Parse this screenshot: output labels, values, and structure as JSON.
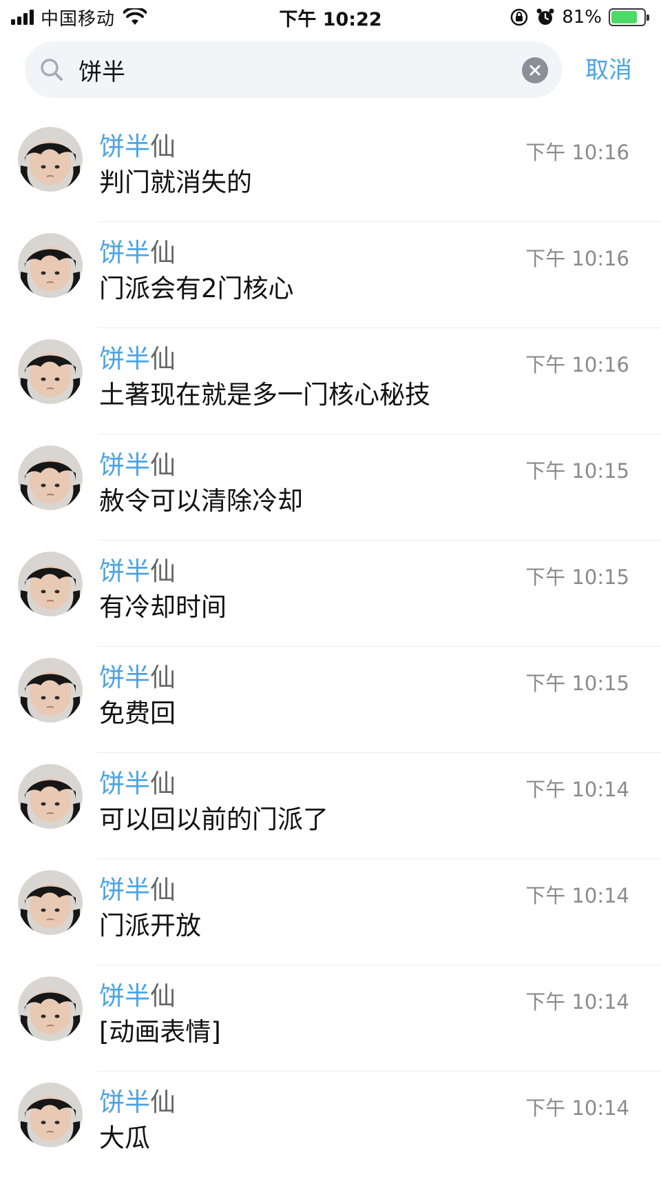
{
  "status": {
    "carrier": "中国移动",
    "time": "下午 10:22",
    "battery": "81%",
    "battery_level": 0.81,
    "icons": [
      "signal-icon",
      "wifi-icon",
      "rotation-lock-icon",
      "alarm-icon",
      "battery-charging-icon"
    ]
  },
  "search": {
    "query": "饼半",
    "cancel_label": "取消",
    "clear_icon": "clear-icon"
  },
  "colors": {
    "accent": "#4aa3e6",
    "highlight": "#4aa3e6",
    "secondary_text": "#8a8a8a"
  },
  "results": [
    {
      "name_match": "饼半",
      "name_rest": "仙",
      "time": "下午 10:16",
      "message": "判门就消失的"
    },
    {
      "name_match": "饼半",
      "name_rest": "仙",
      "time": "下午 10:16",
      "message": "门派会有2门核心"
    },
    {
      "name_match": "饼半",
      "name_rest": "仙",
      "time": "下午 10:16",
      "message": "土著现在就是多一门核心秘技"
    },
    {
      "name_match": "饼半",
      "name_rest": "仙",
      "time": "下午 10:15",
      "message": "赦令可以清除冷却"
    },
    {
      "name_match": "饼半",
      "name_rest": "仙",
      "time": "下午 10:15",
      "message": "有冷却时间"
    },
    {
      "name_match": "饼半",
      "name_rest": "仙",
      "time": "下午 10:15",
      "message": "免费回"
    },
    {
      "name_match": "饼半",
      "name_rest": "仙",
      "time": "下午 10:14",
      "message": "可以回以前的门派了"
    },
    {
      "name_match": "饼半",
      "name_rest": "仙",
      "time": "下午 10:14",
      "message": "门派开放"
    },
    {
      "name_match": "饼半",
      "name_rest": "仙",
      "time": "下午 10:14",
      "message": "[动画表情]"
    },
    {
      "name_match": "饼半",
      "name_rest": "仙",
      "time": "下午 10:14",
      "message": "大瓜"
    }
  ]
}
